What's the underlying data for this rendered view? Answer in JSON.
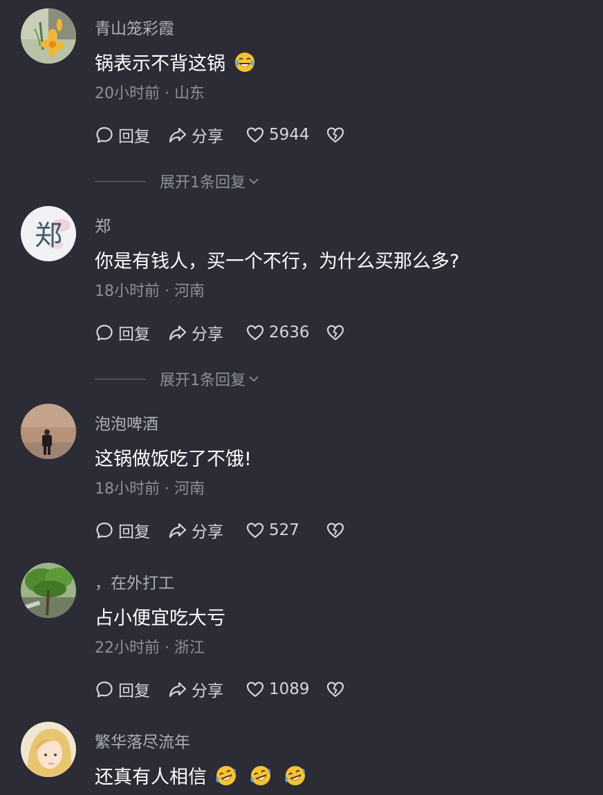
{
  "comments": [
    {
      "username": "青山笼彩霞",
      "content": "锅表示不背这锅",
      "emoji_count": 1,
      "emoji": "laughing-emoji",
      "time": "20小时前 · 山东",
      "likes": "5944",
      "expand": "展开1条回复"
    },
    {
      "username": "郑",
      "content": "你是有钱人，买一个不行，为什么买那么多?",
      "emoji_count": 0,
      "time": "18小时前 · 河南",
      "likes": "2636",
      "expand": "展开1条回复",
      "avatar_char": "郑"
    },
    {
      "username": "泡泡啤酒",
      "content": "这锅做饭吃了不饿!",
      "emoji_count": 0,
      "time": "18小时前 · 河南",
      "likes": "527"
    },
    {
      "username": "，在外打工",
      "content": "占小便宜吃大亏",
      "emoji_count": 0,
      "time": "22小时前 · 浙江",
      "likes": "1089"
    },
    {
      "username": "繁华落尽流年",
      "content": "还真有人相信",
      "emoji_count": 3,
      "emoji": "rofl-emoji"
    }
  ],
  "actions": {
    "reply": "回复",
    "share": "分享"
  },
  "icons": [
    "comment-bubble-icon",
    "share-arrow-icon",
    "heart-icon",
    "broken-heart-icon",
    "chevron-down-icon"
  ],
  "colors": {
    "background": "#2b2c35",
    "username": "#aeb0b8",
    "meta": "#8e9099",
    "text": "#ffffff"
  }
}
